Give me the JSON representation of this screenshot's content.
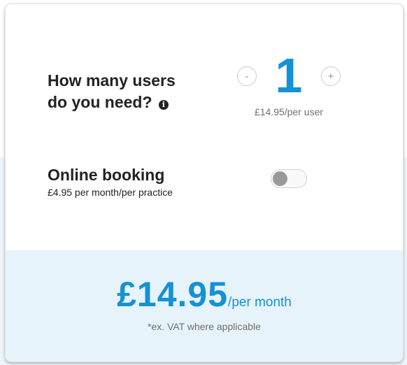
{
  "users": {
    "label_line1": "How many users",
    "label_line2": "do you need?",
    "info_icon": "info-icon",
    "info_glyph": "i",
    "decrement_label": "-",
    "increment_label": "+",
    "count": "1",
    "price_per_user": "£14.95/per user"
  },
  "booking": {
    "label": "Online booking",
    "price": "£4.95 per month/per practice",
    "enabled": false
  },
  "total": {
    "amount": "£14.95",
    "period": "/per month",
    "note": "*ex. VAT where applicable"
  },
  "colors": {
    "accent": "#1591d6",
    "footer_bg": "#e6f3fa",
    "text_dark": "#222222",
    "text_muted": "#6f6f6f"
  }
}
